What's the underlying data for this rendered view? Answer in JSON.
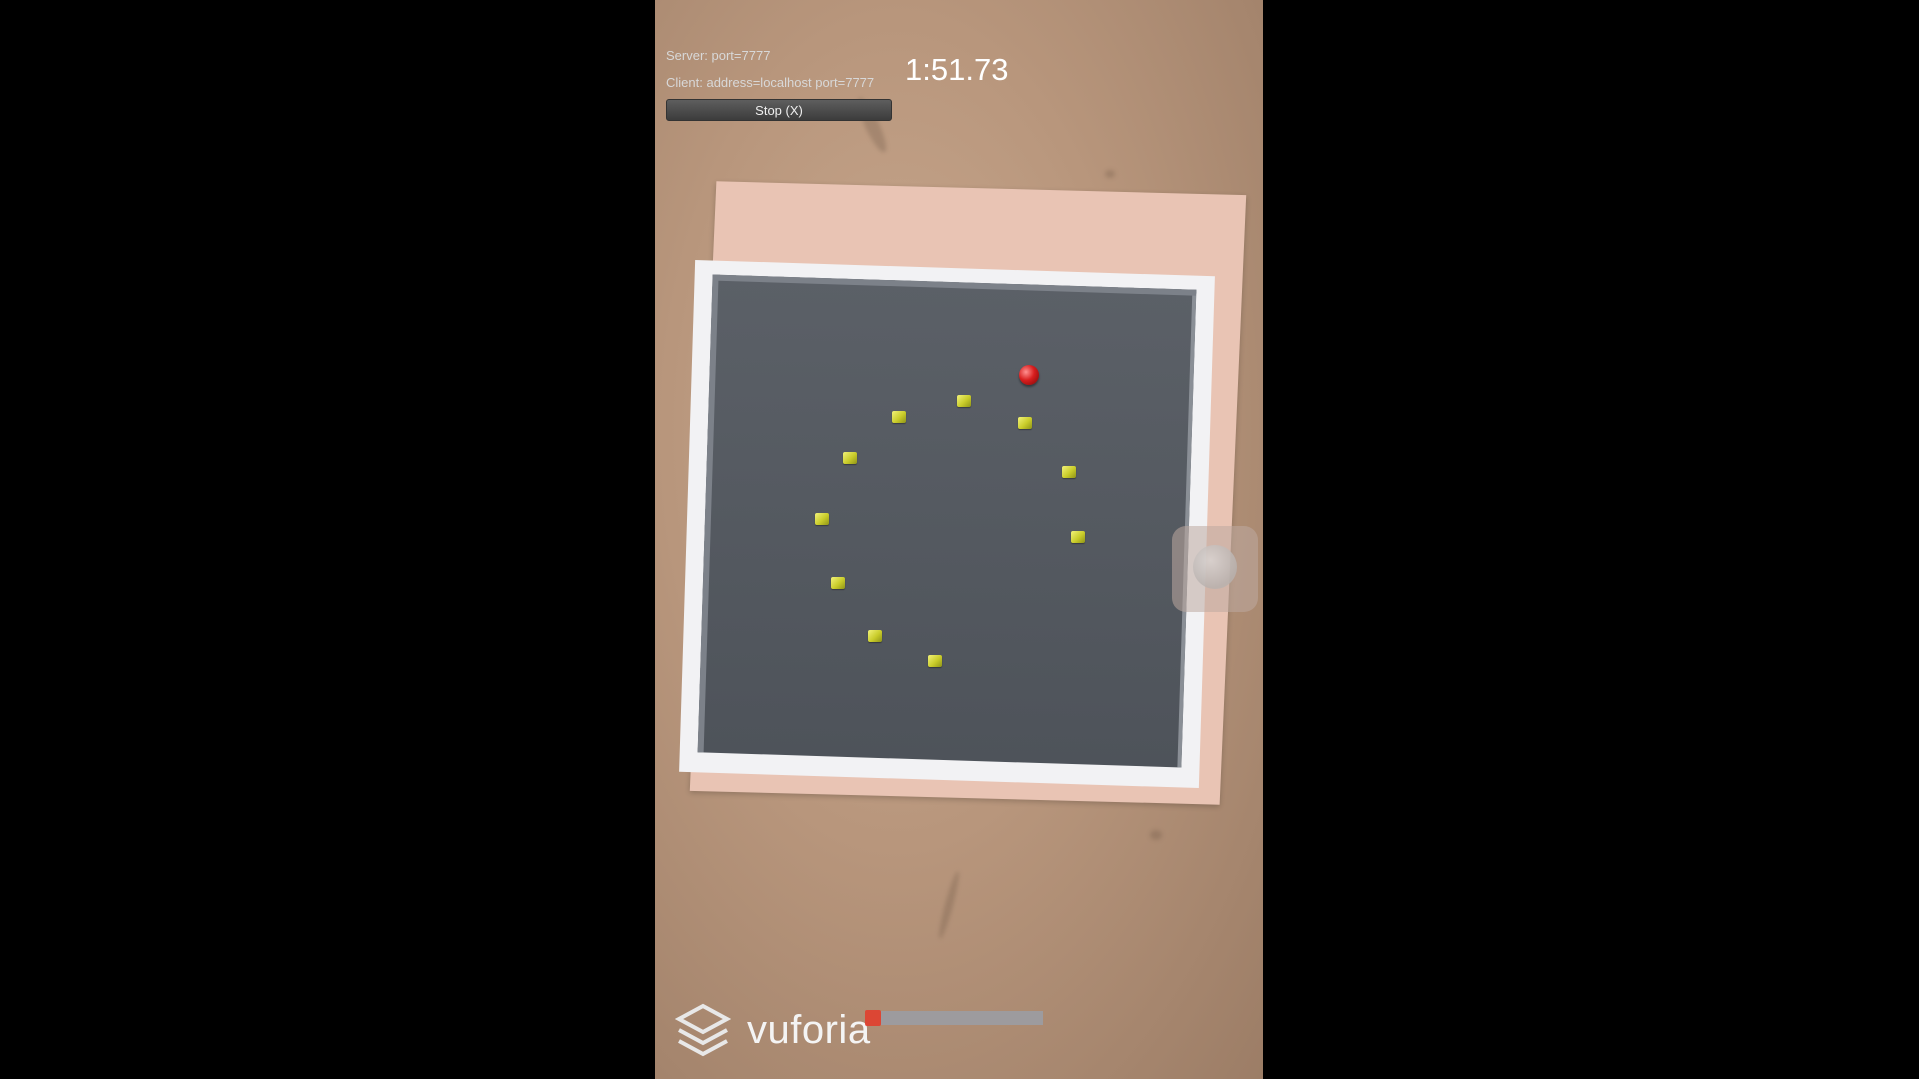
{
  "hud": {
    "server_text": "Server: port=7777",
    "client_text": "Client: address=localhost port=7777",
    "stop_label": "Stop (X)",
    "timer": "1:51.73"
  },
  "branding": {
    "logo_text": "vuforia"
  },
  "playback": {
    "progress": 0.0
  },
  "colors": {
    "ball": "#d81e1e",
    "cube": "#d4d63a",
    "board": "#53585f",
    "progress_handle": "#e53a2a"
  },
  "icons": {
    "logo": "vuforia-logo-icon",
    "joystick": "virtual-joystick-icon"
  }
}
